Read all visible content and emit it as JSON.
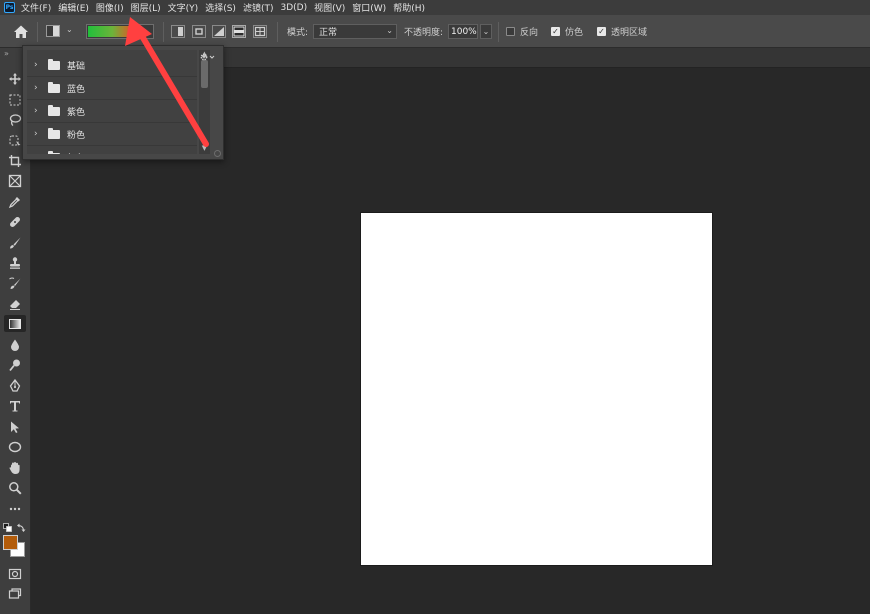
{
  "menu": {
    "logo": "Ps",
    "items": [
      "文件(F)",
      "编辑(E)",
      "图像(I)",
      "图层(L)",
      "文字(Y)",
      "选择(S)",
      "滤镜(T)",
      "3D(D)",
      "视图(V)",
      "窗口(W)",
      "帮助(H)"
    ]
  },
  "options": {
    "mode_label": "模式:",
    "mode_value": "正常",
    "opacity_label": "不透明度:",
    "opacity_value": "100%",
    "reverse_label": "反向",
    "reverse_checked": false,
    "dither_label": "仿色",
    "dither_checked": true,
    "transparency_label": "透明区域",
    "transparency_checked": true,
    "gradient_colors": [
      "#21c03b",
      "#e23b1e"
    ],
    "active_gradient_type": "diamond"
  },
  "preset_panel": {
    "groups": [
      "基础",
      "蓝色",
      "紫色",
      "粉色",
      "红色"
    ]
  },
  "tools": {
    "foreground_color": "#b35c0a",
    "background_color": "#ffffff",
    "active_tool": "gradient-tool"
  },
  "annotation": {
    "arrow_color": "#ff4040"
  }
}
